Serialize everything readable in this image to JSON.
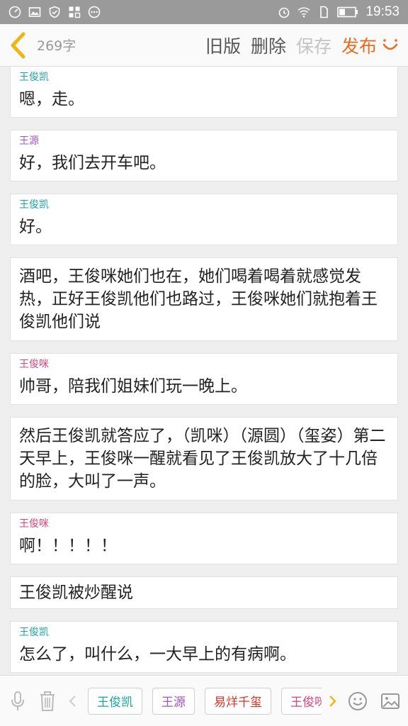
{
  "status_bar": {
    "time": "19:53"
  },
  "header": {
    "word_count": "269字",
    "actions": [
      {
        "label": "旧版",
        "state": "normal"
      },
      {
        "label": "删除",
        "state": "normal"
      },
      {
        "label": "保存",
        "state": "disabled"
      },
      {
        "label": "发布",
        "state": "primary"
      }
    ]
  },
  "colors": {
    "teal": "#1aa3a0",
    "purple": "#a552c7",
    "pink": "#e0407c",
    "red": "#d03a2c",
    "orange": "#e96b1e"
  },
  "messages": [
    {
      "speaker": "王俊凯",
      "speaker_color": "#1aa3a0",
      "text": "嗯，走。"
    },
    {
      "speaker": "王源",
      "speaker_color": "#a552c7",
      "text": "好，我们去开车吧。"
    },
    {
      "speaker": "王俊凯",
      "speaker_color": "#1aa3a0",
      "text": "好。"
    },
    {
      "speaker": "",
      "speaker_color": "",
      "text": "酒吧，王俊咪她们也在，她们喝着喝着就感觉发热，正好王俊凯他们也路过，王俊咪她们就抱着王俊凯他们说"
    },
    {
      "speaker": "王俊咪",
      "speaker_color": "#e0407c",
      "text": "帅哥，陪我们姐妹们玩一晚上。"
    },
    {
      "speaker": "",
      "speaker_color": "",
      "text": "然后王俊凯就答应了，（凯咪）（源圆）（玺姿）第二天早上，王俊咪一醒就看见了王俊凯放大了十几倍的脸，大叫了一声。"
    },
    {
      "speaker": "王俊咪",
      "speaker_color": "#e0407c",
      "text": "啊！！！！！"
    },
    {
      "speaker": "",
      "speaker_color": "",
      "text": "王俊凯被炒醒说"
    },
    {
      "speaker": "王俊凯",
      "speaker_color": "#1aa3a0",
      "text": "怎么了，叫什么，一大早上的有病啊。"
    }
  ],
  "toolbar": {
    "chips": [
      {
        "label": "王俊凯",
        "color": "#1aa3a0"
      },
      {
        "label": "王源",
        "color": "#a552c7"
      },
      {
        "label": "易烊千玺",
        "color": "#d03a2c"
      },
      {
        "label": "王俊咪",
        "color": "#e0407c"
      }
    ]
  }
}
